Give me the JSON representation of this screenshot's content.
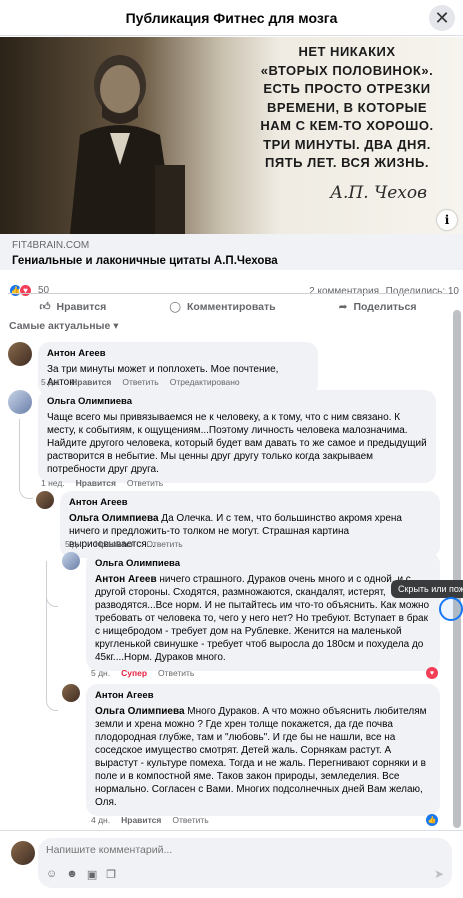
{
  "header": {
    "title": "Публикация Фитнес для мозга"
  },
  "post": {
    "image_quote_lines": [
      "НЕТ НИКАКИХ",
      "«ВТОРЫХ ПОЛОВИНОК».",
      "ЕСТЬ ПРОСТО ОТРЕЗКИ",
      "ВРЕМЕНИ, В КОТОРЫЕ",
      "НАМ С КЕМ-ТО ХОРОШО.",
      "ТРИ МИНУТЫ. ДВА ДНЯ.",
      "ПЯТЬ ЛЕТ. ВСЯ ЖИЗНЬ."
    ],
    "image_signature": "А.П. Чехов",
    "link_domain": "FIT4BRAIN.COM",
    "link_title": "Гениальные и лаконичные цитаты А.П.Чехова",
    "reactions_count": "50",
    "comments_count": "2 комментария",
    "shares_count": "Поделились: 10"
  },
  "actions": {
    "like": "Нравится",
    "comment": "Комментировать",
    "share": "Поделиться"
  },
  "sort_label": "Самые актуальные",
  "comments": [
    {
      "author": "Антон Агеев",
      "text": "За три минуты может и поплохеть. Мое почтение, Антон.",
      "time": "5 дн.",
      "like": "Нравится",
      "reply": "Ответить",
      "edited": "Отредактировано"
    },
    {
      "author": "Ольга Олимпиева",
      "text": "Чаще всего мы привязываемся не к человеку, а к тому, что с ним связано. К месту, к событиям, к ощущениям...Поэтому личность человека малозначима. Найдите другого человека, который будет вам давать то же самое и предыдущий растворится в небытие. Мы ценны друг другу только когда закрываем потребности друг друга.",
      "time": "1 нед.",
      "like": "Нравится",
      "reply": "Ответить"
    },
    {
      "author": "Антон Агеев",
      "mention": "Ольга Олимпиева",
      "text": " Да Олечка. И с тем, что большинство акромя хрена ничего и предложить-то толком не могут. Страшная картина вырисовывается...",
      "time": "5 дн.",
      "like": "Нравится",
      "reply": "Ответить"
    },
    {
      "author": "Ольга Олимпиева",
      "mention": "Антон Агеев",
      "text": " ничего страшного. Дураков очень много и с одной, и с другой стороны. Сходятся, размножаются, скандалят, истерят, разводятся...Все норм. И не пытайтесь им что-то объяснить. Как можно требовать от человека то, чего у него нет? Но требуют. Вступает в брак с нищебродом - требует дом на Рублевке. Женится на маленькой кругленькой свинушке - требует чтоб выросла до 180см и похудела до 45кг....Норм. Дураков много.",
      "time": "5 дн.",
      "like": "Супер",
      "reply": "Ответить"
    },
    {
      "author": "Антон Агеев",
      "mention": "Ольга Олимпиева",
      "text": " Много Дураков. А что можно объяснить любителям земли и хрена можно ? Где хрен толще покажется, да где почва плодородная глубже, там и \"любовь\". И где бы не нашли, все на соседское имущество смотрят. Детей жаль. Сорнякам растут. А вырастут - культуре помеха. Тогда и не жаль. Перегнивают сорняки и в поле и в компостной яме. Таков закон природы, земледелия. Все нормально. Согласен с Вами. Многих подсолнечных дней Вам желаю, Оля.",
      "time": "4 дн.",
      "like": "Нравится",
      "reply": "Ответить"
    }
  ],
  "tooltip": "Скрыть или пож",
  "composer": {
    "placeholder": "Напишите комментарий..."
  },
  "colors": {
    "accent": "#1877f2",
    "love": "#f33e58",
    "super": "#e41e3f"
  }
}
